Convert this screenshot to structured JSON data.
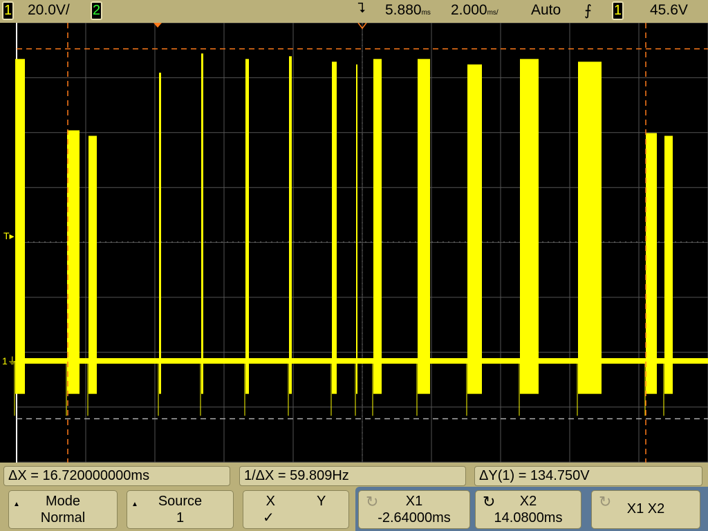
{
  "header": {
    "ch1": "1",
    "ch1_scale": "20.0V/",
    "ch2": "2",
    "delay": "5.880",
    "delay_unit": "ms",
    "timebase": "2.000",
    "timebase_unit": "ms/",
    "trigger_mode": "Auto",
    "trigger_slope_icon": "rising-edge-icon",
    "trigger_source": "1",
    "trigger_level": "45.6V"
  },
  "markers": {
    "trigger_level": "T",
    "ground": "1"
  },
  "readouts": {
    "delta_x": "ΔX = 16.720000000ms",
    "inv_delta_x": "1/ΔX = 59.809Hz",
    "delta_y": "ΔY(1) = 134.750V"
  },
  "softkeys": {
    "mode_label": "Mode",
    "mode_value": "Normal",
    "source_label": "Source",
    "source_value": "1",
    "x_label": "X",
    "y_label": "Y",
    "xy_check": "✓",
    "x1_label": "X1",
    "x1_value": "-2.64000ms",
    "x2_label": "X2",
    "x2_value": "14.0800ms",
    "x1x2_label": "X1 X2"
  },
  "scope": {
    "center_time_ms": 5.88,
    "ms_per_div": 2.0,
    "volts_per_div": 20.0,
    "x1_ms": -2.64,
    "x2_ms": 14.08,
    "y1_v": 113.7,
    "y2_v": -21.05,
    "trace_color": "#ffff00",
    "bursts": [
      [
        -4.16,
        -3.88,
        110
      ],
      [
        -2.66,
        -2.3,
        84
      ],
      [
        -2.04,
        -1.8,
        82
      ],
      [
        0.0,
        0.06,
        105
      ],
      [
        1.22,
        1.28,
        112
      ],
      [
        2.5,
        2.6,
        110
      ],
      [
        3.76,
        3.84,
        111
      ],
      [
        5.0,
        5.14,
        109
      ],
      [
        5.7,
        5.72,
        108
      ],
      [
        6.2,
        6.44,
        110
      ],
      [
        7.48,
        7.84,
        110
      ],
      [
        8.92,
        9.34,
        108
      ],
      [
        10.44,
        10.98,
        110
      ],
      [
        12.12,
        12.8,
        109
      ],
      [
        14.08,
        14.4,
        83
      ],
      [
        14.62,
        14.86,
        82
      ]
    ]
  }
}
